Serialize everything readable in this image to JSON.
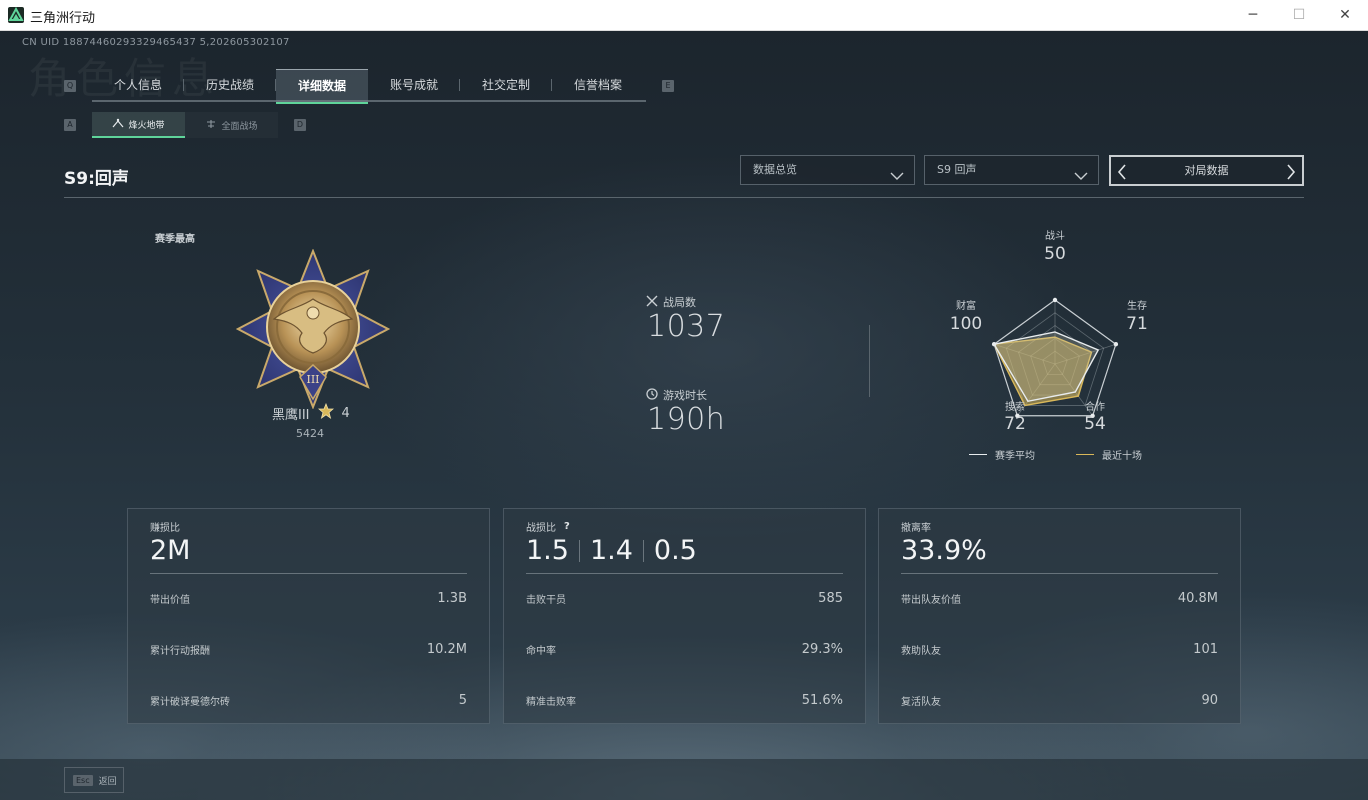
{
  "window": {
    "title": "三角洲行动",
    "min_icon": "minimize-icon",
    "max_icon": "maximize-icon",
    "close_icon": "close-icon"
  },
  "uid": "CN UID 18874460293329465437 5,202605302107",
  "watermark": "角色信息",
  "main_tabs": {
    "left_key": "Q",
    "right_key": "E",
    "items": [
      {
        "label": "个人信息"
      },
      {
        "label": "历史战绩"
      },
      {
        "label": "详细数据",
        "active": true
      },
      {
        "label": "账号成就"
      },
      {
        "label": "社交定制"
      },
      {
        "label": "信誉档案"
      }
    ]
  },
  "sub_tabs": {
    "left_key": "A",
    "right_key": "D",
    "items": [
      {
        "label": "烽火地带",
        "icon": "beacon-icon",
        "active": true
      },
      {
        "label": "全面战场",
        "icon": "battlefield-icon"
      }
    ]
  },
  "season_title": "S9:回声",
  "filters": {
    "overview": "数据总览",
    "season": "S9 回声",
    "pager_label": "对局数据"
  },
  "rank": {
    "label": "赛季最高",
    "name": "黑鹰III",
    "stars": "4",
    "score": "5424"
  },
  "stats": {
    "matches_label": "战局数",
    "matches_value": "1037",
    "playtime_label": "游戏时长",
    "playtime_value": "190h"
  },
  "radar": {
    "axes": [
      {
        "label": "战斗",
        "value": 50
      },
      {
        "label": "生存",
        "value": 71
      },
      {
        "label": "合作",
        "value": 54
      },
      {
        "label": "搜索",
        "value": 72
      },
      {
        "label": "财富",
        "value": 100
      }
    ],
    "recent_values": [
      42,
      60,
      62,
      80,
      100
    ],
    "legend_season": "赛季平均",
    "legend_recent": "最近十场",
    "colors": {
      "season": "#e8ecee",
      "recent": "#d9b85a"
    }
  },
  "cards": [
    {
      "title": "赚损比",
      "big": [
        "2M"
      ],
      "rows": [
        {
          "label": "带出价值",
          "value": "1.3B"
        },
        {
          "label": "累计行动报酬",
          "value": "10.2M"
        },
        {
          "label": "累计破译曼德尔砖",
          "value": "5"
        }
      ]
    },
    {
      "title": "战损比",
      "help": "?",
      "big": [
        "1.5",
        "1.4",
        "0.5"
      ],
      "rows": [
        {
          "label": "击败干员",
          "value": "585"
        },
        {
          "label": "命中率",
          "value": "29.3%"
        },
        {
          "label": "精准击败率",
          "value": "51.6%"
        }
      ]
    },
    {
      "title": "撤离率",
      "big": [
        "33.9%"
      ],
      "rows": [
        {
          "label": "带出队友价值",
          "value": "40.8M"
        },
        {
          "label": "救助队友",
          "value": "101"
        },
        {
          "label": "复活队友",
          "value": "90"
        }
      ]
    }
  ],
  "footer": {
    "esc_key": "Esc",
    "back_label": "返回"
  }
}
